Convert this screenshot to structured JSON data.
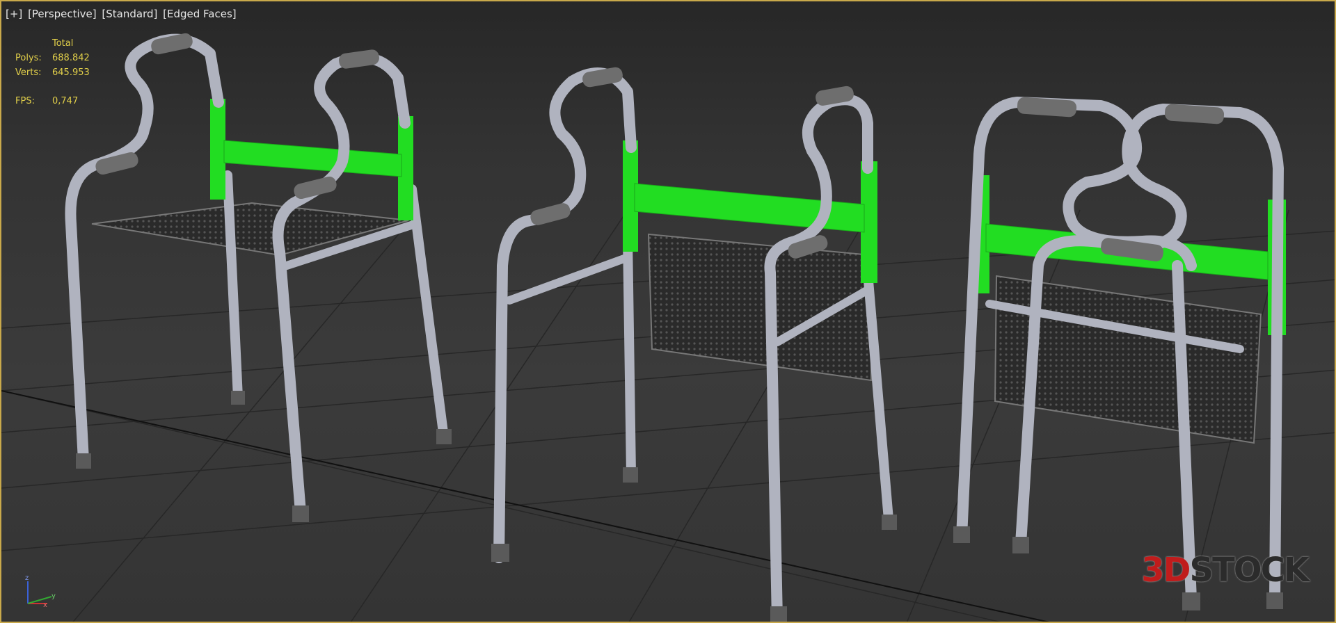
{
  "viewport": {
    "labels": [
      "[+]",
      "[Perspective]",
      "[Standard]",
      "[Edged Faces]"
    ]
  },
  "stats": {
    "header": "Total",
    "polys_label": "Polys:",
    "polys_value": "688.842",
    "verts_label": "Verts:",
    "verts_value": "645.953",
    "fps_label": "FPS:",
    "fps_value": "0,747"
  },
  "watermark": {
    "part1": "3D",
    "part2": "STOCK"
  },
  "gizmo": {
    "z": "z",
    "x": "x",
    "y": "y"
  },
  "colors": {
    "frame": "#c9a94b",
    "tube": "#b0b3bf",
    "green_bar": "#22dd22",
    "grip": "#6e6e6e",
    "stats_text": "#e2d04a"
  }
}
